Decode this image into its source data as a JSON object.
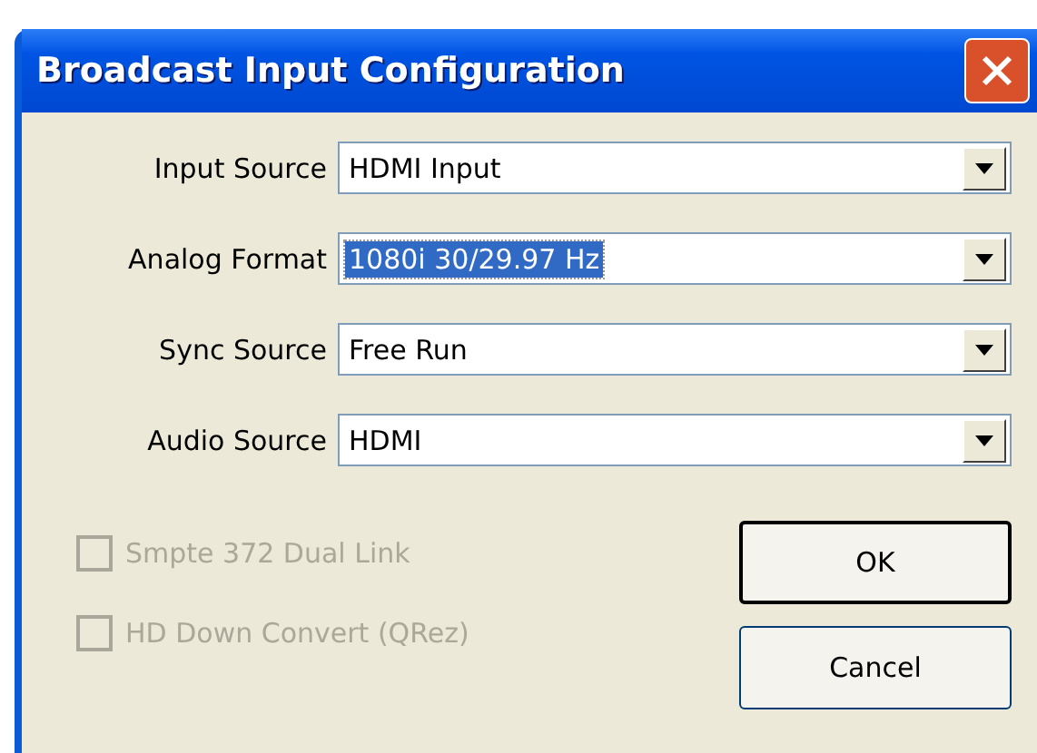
{
  "window": {
    "title": "Broadcast Input Configuration"
  },
  "fields": [
    {
      "label": "Input Source",
      "value": "HDMI Input",
      "text_selected": false
    },
    {
      "label": "Analog Format",
      "value": "1080i 30/29.97 Hz",
      "text_selected": true
    },
    {
      "label": "Sync Source",
      "value": "Free Run",
      "text_selected": false
    },
    {
      "label": "Audio Source",
      "value": "HDMI",
      "text_selected": false
    }
  ],
  "checkboxes": [
    {
      "label": "Smpte 372 Dual Link",
      "checked": false,
      "disabled": true
    },
    {
      "label": "HD Down Convert (QRez)",
      "checked": false,
      "disabled": true
    }
  ],
  "buttons": [
    {
      "label": "OK",
      "default": true
    },
    {
      "label": "Cancel",
      "default": false
    }
  ]
}
